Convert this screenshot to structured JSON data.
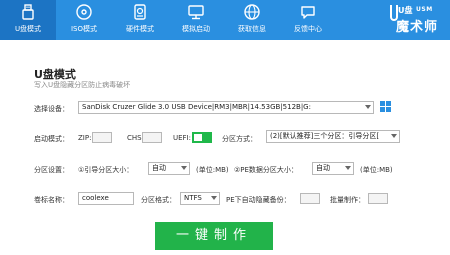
{
  "nav": {
    "tabs": [
      {
        "label": "U盘模式",
        "icon": "usb-icon"
      },
      {
        "label": "ISO模式",
        "icon": "disc-icon"
      },
      {
        "label": "硬件模式",
        "icon": "harddrive-icon"
      },
      {
        "label": "模拟启动",
        "icon": "monitor-icon"
      },
      {
        "label": "获取信息",
        "icon": "globe-icon"
      },
      {
        "label": "反馈中心",
        "icon": "chat-icon"
      }
    ],
    "active_index": 0
  },
  "logo": {
    "top": "U盘",
    "usm": "USM",
    "main": "魔术师"
  },
  "main": {
    "title": "U盘模式",
    "subtitle": "写入U盘隐藏分区防止病毒破坏"
  },
  "form": {
    "device_label": "选择设备：",
    "device_value": "SanDisk Cruzer Glide 3.0 USB Device|RM3|MBR|14.53GB|512B|G:",
    "boot_label": "启动模式：",
    "zip_label": "ZIP:",
    "chs_label": "CHS:",
    "uefi_label": "UEFI:",
    "uefi_on": true,
    "partition_mode_label": "分区方式：",
    "partition_mode_value": "(2)[默认推荐]三个分区：引导分区[",
    "partition_settings_label": "分区设置：",
    "part1_label": "①引导分区大小：",
    "part1_value": "自动",
    "part1_unit": "(单位:MB)",
    "part2_label": "②PE数据分区大小：",
    "part2_value": "自动",
    "part2_unit": "(单位:MB)",
    "volume_label": "卷标名称：",
    "volume_value": "coolexe",
    "fs_label": "分区格式：",
    "fs_value": "NTFS",
    "pe_backup_label": "PE下自动隐藏备份：",
    "batch_label": "批量制作："
  },
  "action": {
    "make_label": "一键制作"
  },
  "colors": {
    "accent": "#2a8fe0",
    "active_tab": "#1c74c4",
    "button": "#22b34a"
  }
}
